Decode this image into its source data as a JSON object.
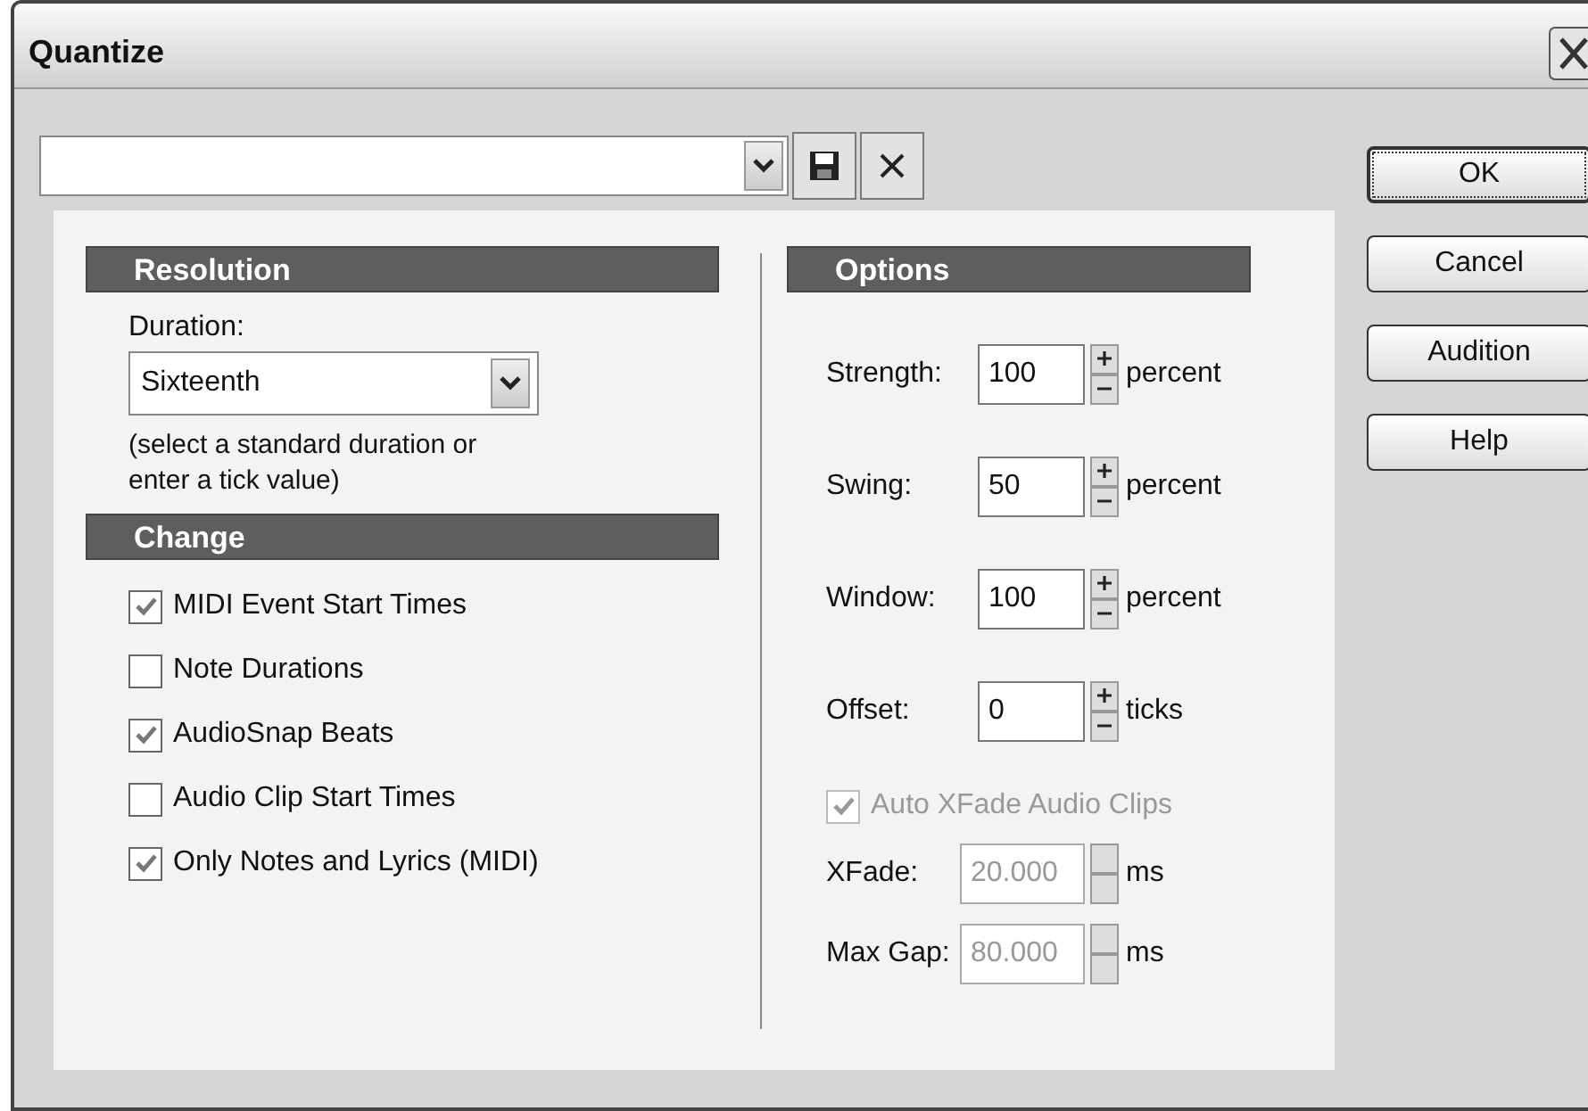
{
  "window": {
    "title": "Quantize"
  },
  "resolution": {
    "heading": "Resolution",
    "duration_label": "Duration:",
    "duration": "Sixteenth",
    "hint": "(select a standard duration or enter a tick value)"
  },
  "change": {
    "heading": "Change",
    "options": [
      {
        "label": "MIDI Event Start Times",
        "checked": true
      },
      {
        "label": "Note Durations",
        "checked": false
      },
      {
        "label": "AudioSnap Beats",
        "checked": true
      },
      {
        "label": "Audio Clip Start Times",
        "checked": false
      },
      {
        "label": "Only Notes and Lyrics (MIDI)",
        "checked": true
      }
    ]
  },
  "options": {
    "heading": "Options",
    "fields": [
      {
        "label": "Strength:",
        "value": "100",
        "unit": "percent",
        "disabled": false
      },
      {
        "label": "Swing:",
        "value": "50",
        "unit": "percent",
        "disabled": false
      },
      {
        "label": "Window:",
        "value": "100",
        "unit": "percent",
        "disabled": false
      },
      {
        "label": "Offset:",
        "value": "0",
        "unit": "ticks",
        "disabled": false
      }
    ],
    "auto_xfade": {
      "label": "Auto XFade Audio Clips",
      "checked": true,
      "disabled": true
    },
    "fades": [
      {
        "label": "XFade:",
        "value": "20.000",
        "unit": "ms",
        "disabled": true
      },
      {
        "label": "Max Gap:",
        "value": "80.000",
        "unit": "ms",
        "disabled": true
      }
    ]
  },
  "buttons": [
    {
      "label": "OK",
      "default": true
    },
    {
      "label": "Cancel",
      "default": false
    },
    {
      "label": "Audition",
      "default": false
    },
    {
      "label": "Help",
      "default": false
    }
  ]
}
